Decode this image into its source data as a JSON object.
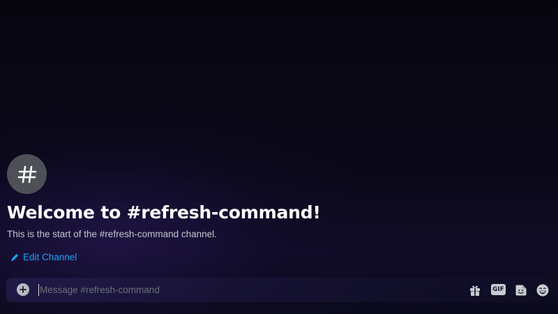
{
  "channel": {
    "name": "refresh-command",
    "avatar_icon": "hash-icon"
  },
  "welcome": {
    "title": "Welcome to #refresh-command!",
    "subtitle": "This is the start of the #refresh-command channel.",
    "edit_label": "Edit Channel",
    "edit_icon": "pencil-icon"
  },
  "composer": {
    "value": "",
    "placeholder": "Message #refresh-command",
    "add_icon": "plus-circle-icon",
    "tools": {
      "gift_icon": "gift-icon",
      "gif_label": "GIF",
      "sticker_icon": "sticker-icon",
      "emoji_icon": "emoji-icon"
    }
  },
  "colors": {
    "link": "#1aa4f5",
    "avatar_bg": "#4e5058",
    "icon": "#c8cbd0"
  }
}
